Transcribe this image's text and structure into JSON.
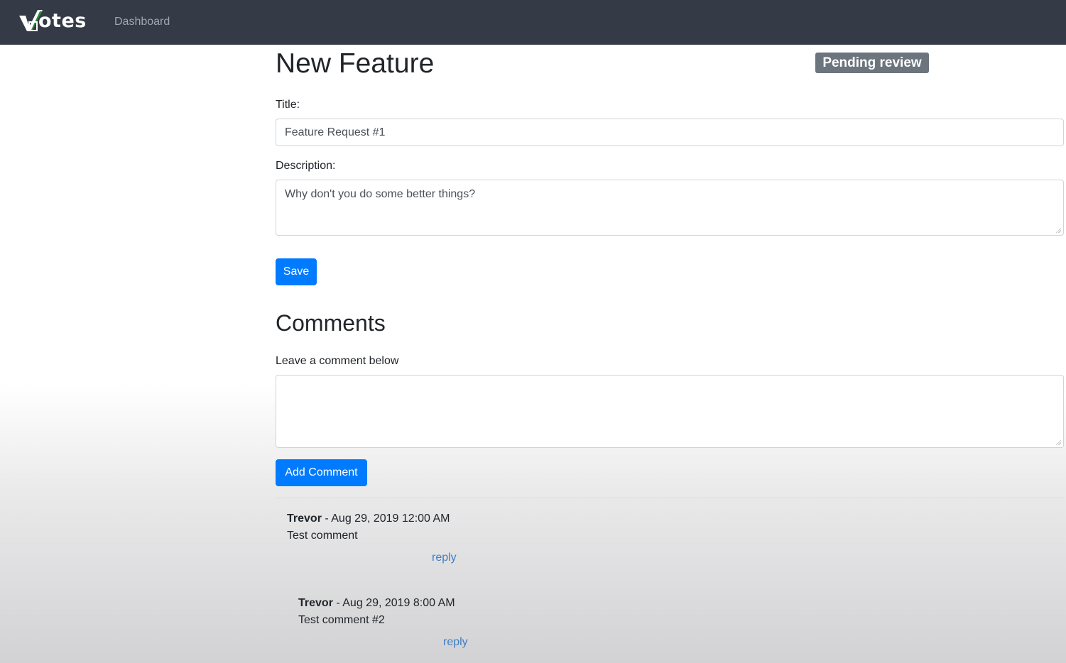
{
  "navbar": {
    "brand": "otes",
    "links": [
      "Dashboard"
    ]
  },
  "page": {
    "title": "New Feature",
    "status_badge": "Pending review"
  },
  "form": {
    "title_label": "Title:",
    "title_value": "Feature Request #1",
    "description_label": "Description:",
    "description_value": "Why don't you do some better things?",
    "save_label": "Save"
  },
  "comments": {
    "heading": "Comments",
    "prompt": "Leave a comment below",
    "new_comment_value": "",
    "add_label": "Add Comment",
    "items": [
      {
        "author": "Trevor",
        "date": " - Aug 29, 2019 12:00 AM",
        "text": "Test comment",
        "reply_label": "reply"
      },
      {
        "author": "Trevor",
        "date": " - Aug 29, 2019 8:00 AM",
        "text": "Test comment #2",
        "reply_label": "reply"
      }
    ]
  },
  "colors": {
    "navbar": "#343a46",
    "primary": "#007bff",
    "badge": "#6c757d",
    "logo_check": "#2e8b3a"
  }
}
